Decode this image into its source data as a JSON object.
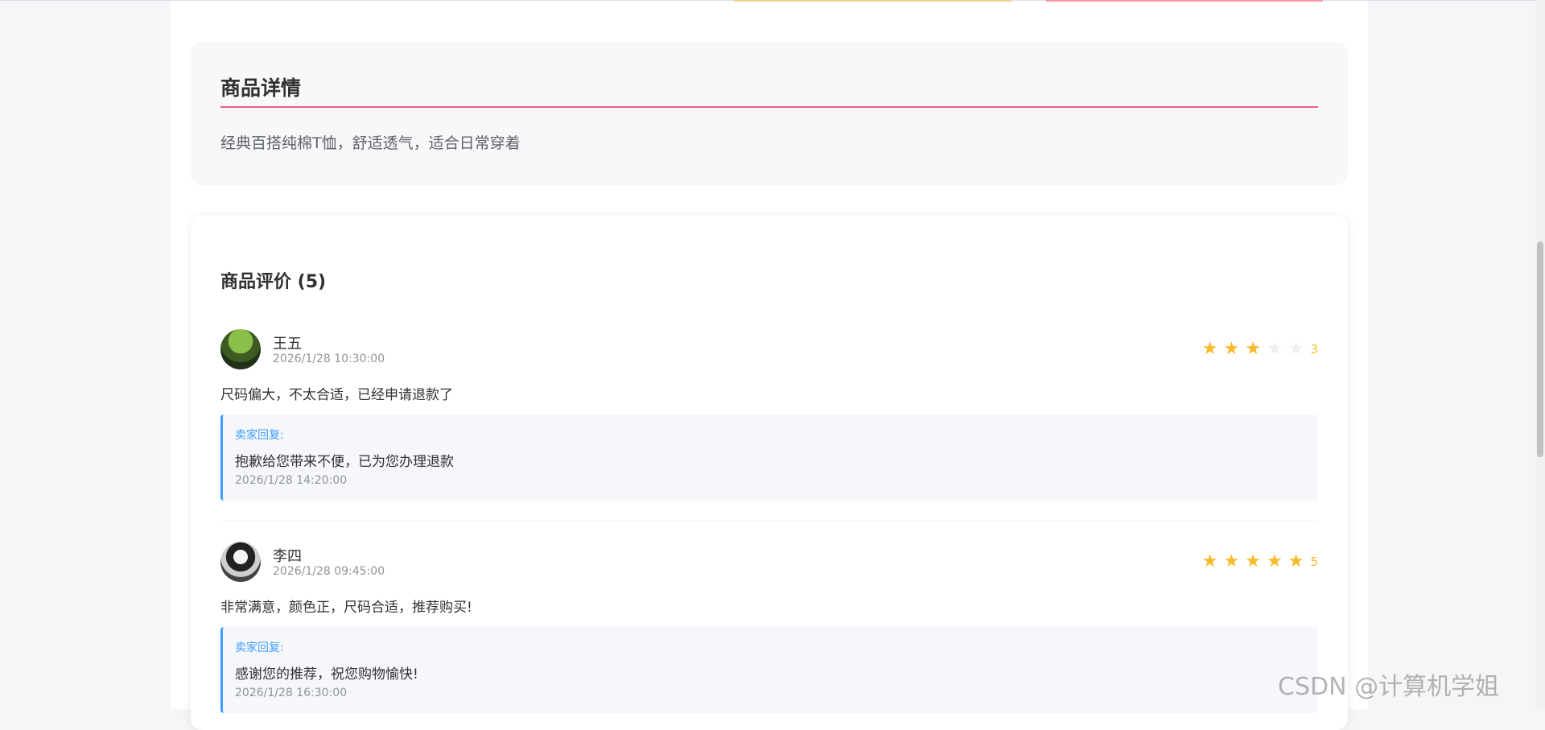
{
  "product_detail": {
    "title": "商品详情",
    "description": "经典百搭纯棉T恤，舒适透气，适合日常穿着"
  },
  "reviews": {
    "heading": "商品评价 (5)",
    "items": [
      {
        "username": "王五",
        "time": "2026/1/28 10:30:00",
        "rating": 3,
        "rating_label": "3",
        "content": "尺码偏大，不太合适，已经申请退款了",
        "reply_label": "卖家回复:",
        "reply_text": "抱歉给您带来不便，已为您办理退款",
        "reply_time": "2026/1/28 14:20:00"
      },
      {
        "username": "李四",
        "time": "2026/1/28 09:45:00",
        "rating": 5,
        "rating_label": "5",
        "content": "非常满意，颜色正，尺码合适，推荐购买!",
        "reply_label": "卖家回复:",
        "reply_text": "感谢您的推荐，祝您购物愉快!",
        "reply_time": "2026/1/28 16:30:00"
      }
    ]
  },
  "watermark": "CSDN @计算机学姐",
  "colors": {
    "star_on": "#f7ba2a",
    "star_off": "#eceef2",
    "reply_accent": "#409eff",
    "title_rule": "#ee5a8a"
  }
}
